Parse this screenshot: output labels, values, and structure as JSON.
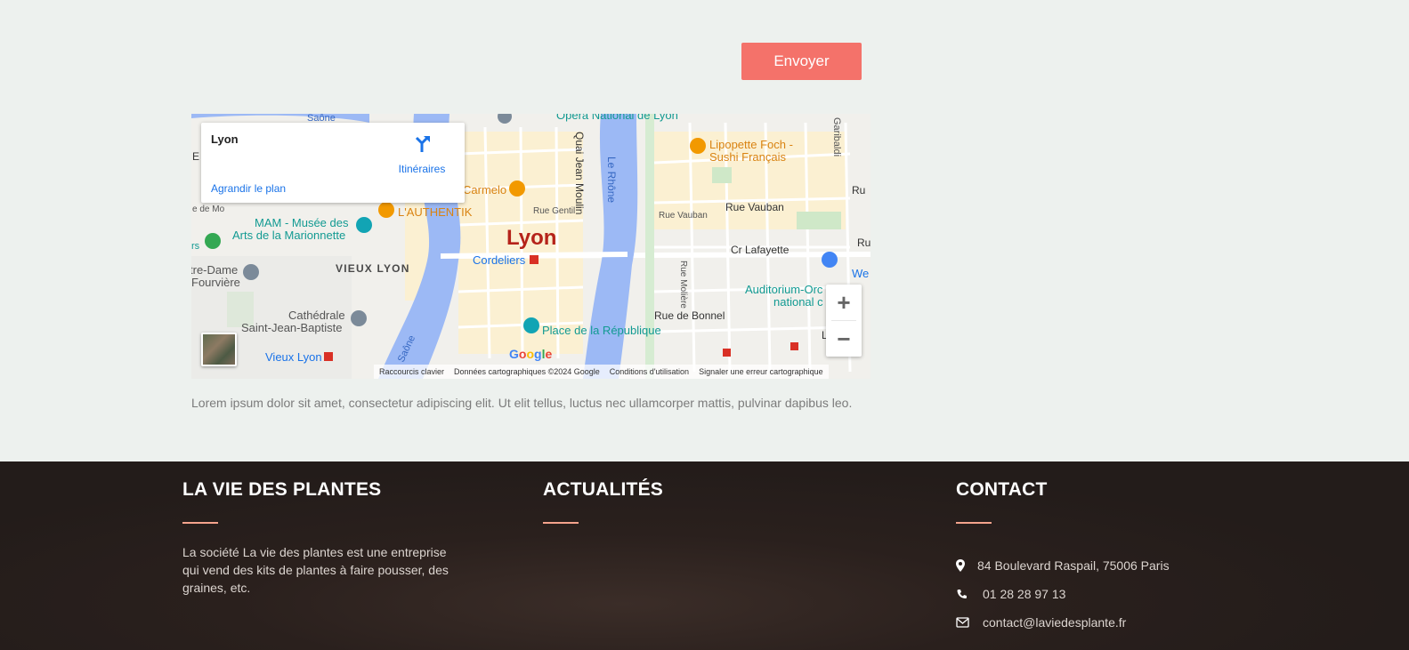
{
  "form": {
    "submit_label": "Envoyer"
  },
  "map": {
    "info_title": "Lyon",
    "directions_label": "Itinéraires",
    "enlarge_label": "Agrandir le plan",
    "zoom_in": "+",
    "zoom_out": "−",
    "google_logo": "Google",
    "attribution": {
      "shortcuts": "Raccourcis clavier",
      "map_data": "Données cartographiques ©2024 Google",
      "terms": "Conditions d'utilisation",
      "report": "Signaler une erreur cartographique"
    },
    "labels": {
      "city": "Lyon",
      "opera": "Opéra National de Lyon",
      "lipopette": "Lipopette Foch -",
      "lipopette2": "Sushi Français",
      "carmelo": "Carmelo",
      "authentik": "L'AUTHENTIK",
      "mam1": "MAM - Musée des",
      "mam2": "Arts de la Marionnette",
      "vieux_lyon": "VIEUX LYON",
      "notre_dame1": "tre-Dame",
      "notre_dame2": "Fourvière",
      "cathedrale1": "Cathédrale",
      "cathedrale2": "Saint-Jean-Baptiste",
      "vieux_lyon_metro": "Vieux Lyon",
      "cordeliers": "Cordeliers",
      "place_rep": "Place de la République",
      "auditorium1": "Auditorium-Orc",
      "auditorium2": "national c",
      "quai": "Quai Jean Moulin",
      "le_rhone": "Le Rhône",
      "saone_top": "Saône",
      "saone_bottom": "Saône",
      "rue_gentil": "Rue Gentil",
      "rue_vauban_small": "Rue Vauban",
      "rue_vauban": "Rue Vauban",
      "cr_lafayette": "Cr Lafayette",
      "rue_moliere": "Rue Molière",
      "rue_bonnel": "Rue de Bonnel",
      "garibaldi": "Garibaldi",
      "ru_edge": "Ru",
      "we_edge": "We",
      "ru_edge2": "Ru",
      "l_r": "L  R",
      "e_edge": "E",
      "de_mo": "e de Mo",
      "rs": "rs"
    }
  },
  "intro_text": "Lorem ipsum dolor sit amet, consectetur adipiscing elit. Ut elit tellus, luctus nec ullamcorper mattis, pulvinar dapibus leo.",
  "footer": {
    "about": {
      "heading": "LA VIE DES PLANTES",
      "text": "La société La vie des plantes est une entreprise qui vend des kits de plantes à faire pousser, des graines, etc."
    },
    "news": {
      "heading": "ACTUALITÉS"
    },
    "contact": {
      "heading": "CONTACT",
      "address": "84 Boulevard Raspail, 75006 Paris",
      "phone": "01 28 28 97 13",
      "email": "contact@laviedesplante.fr"
    }
  },
  "colors": {
    "accent": "#f4726a",
    "footer_bg": "#231c1a",
    "footer_rule": "#f4a38c",
    "map_water": "#9cb9f5",
    "map_link": "#1a73e8"
  }
}
